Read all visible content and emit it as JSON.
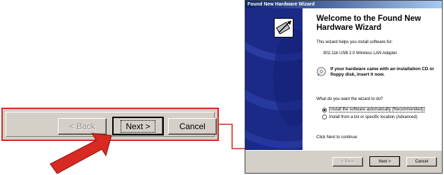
{
  "wizard": {
    "window_title": "Found New Hardware Wizard",
    "heading": "Welcome to the Found New Hardware Wizard",
    "intro": "This wizard helps you install software for:",
    "device_name": "802.11b USB 2.0 Wireless LAN Adapter",
    "cd_prompt": "If your hardware came with an installation CD or floppy disk, insert it now.",
    "question": "What do you want the wizard to do?",
    "options": [
      {
        "label": "Install the software automatically (Recommended)",
        "selected": true
      },
      {
        "label": "Install from a list or specific location (Advanced)",
        "selected": false
      }
    ],
    "continue_text": "Click Next to continue.",
    "buttons": {
      "back": "< Back",
      "next": "Next >",
      "cancel": "Cancel"
    }
  },
  "zoom": {
    "buttons": {
      "back": "< Back",
      "next": "Next >",
      "cancel": "Cancel"
    }
  },
  "colors": {
    "highlight_red": "#d62a22",
    "side_panel_blue": "#1b2a86",
    "title_bar_blue": "#0a246a",
    "dialog_gray": "#d4d0c8"
  }
}
